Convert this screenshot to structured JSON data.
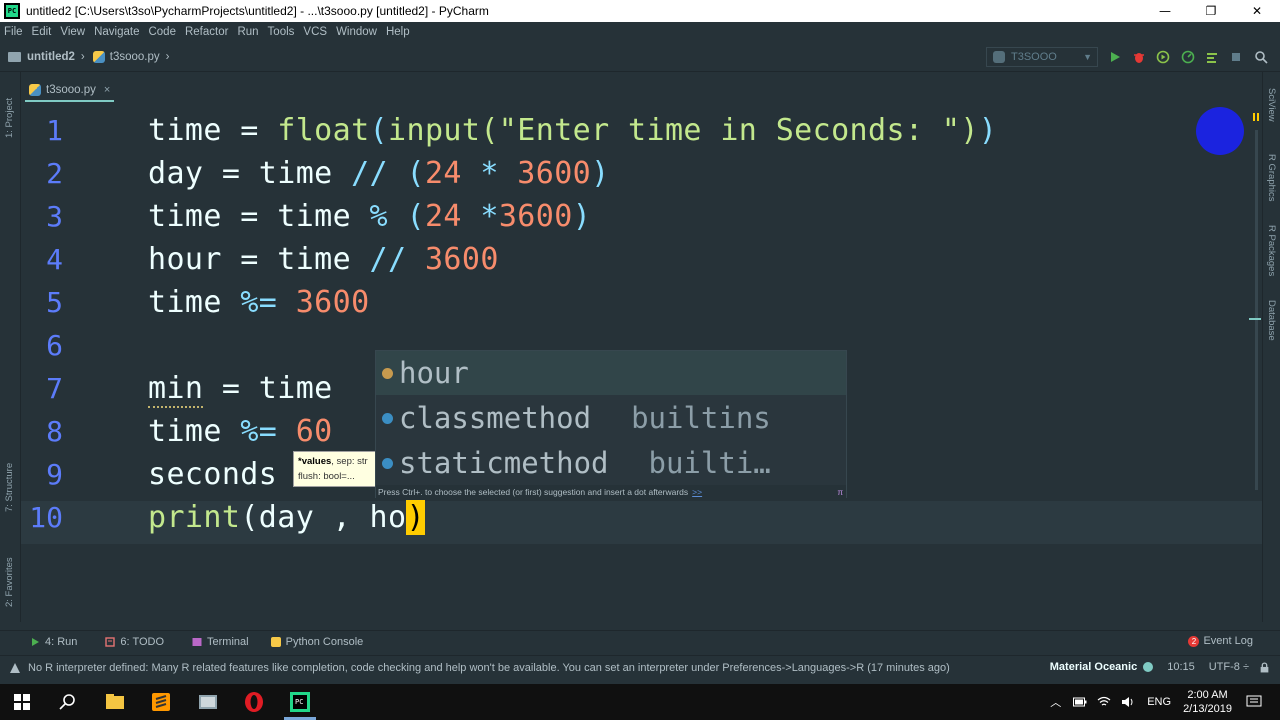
{
  "window": {
    "title": "untitled2 [C:\\Users\\t3so\\PycharmProjects\\untitled2] - ...\\t3sooo.py [untitled2] - PyCharm",
    "app_icon_text": "PC",
    "minimize": "—",
    "maximize": "❐",
    "close": "✕"
  },
  "menu": [
    "File",
    "Edit",
    "View",
    "Navigate",
    "Code",
    "Refactor",
    "Run",
    "Tools",
    "VCS",
    "Window",
    "Help"
  ],
  "navbar": {
    "project": "untitled2",
    "file": "t3sooo.py",
    "run_config": "T3SOOO"
  },
  "left_tools": {
    "project": "1: Project",
    "structure": "7: Structure",
    "favorites": "2: Favorites"
  },
  "right_tools": {
    "sciview": "SciView",
    "r_graphics": "R Graphics",
    "r_packages": "R Packages",
    "database": "Database"
  },
  "tab": {
    "name": "t3sooo.py",
    "close": "×"
  },
  "editor": {
    "line_numbers": [
      "1",
      "2",
      "3",
      "4",
      "5",
      "6",
      "7",
      "8",
      "9",
      "10"
    ],
    "lines": {
      "l1": {
        "a": "time = ",
        "b": "float",
        "c": "(",
        "d": "input",
        "e": "(\"Enter time in Seconds: \")",
        "f": ")"
      },
      "l2": {
        "a": "day = time ",
        "b": "//",
        "c": " (",
        "d": "24",
        "e": " * ",
        "f": "3600",
        "g": ")"
      },
      "l3": {
        "a": "time = time ",
        "b": "%",
        "c": " (",
        "d": "24",
        "e": " *",
        "f": "3600",
        "g": ")"
      },
      "l4": {
        "a": "hour = time ",
        "b": "//",
        "c": " ",
        "d": "3600"
      },
      "l5": {
        "a": "time ",
        "b": "%=",
        "c": " ",
        "d": "3600"
      },
      "l7": {
        "a": "min",
        "b": " = time"
      },
      "l8": {
        "a": "time ",
        "b": "%=",
        "c": " ",
        "d": "60"
      },
      "l9": {
        "a": "seconds"
      },
      "l10": {
        "a": "print",
        "b": "(day , ho",
        "c": ")"
      }
    }
  },
  "param_hint": {
    "line1_bold": "*values",
    "line1_rest": ", sep: str",
    "line2": "flush: bool=..."
  },
  "completion": {
    "items": [
      {
        "name": "hour",
        "source": ""
      },
      {
        "name": "classmethod",
        "source": "builtins"
      },
      {
        "name": "staticmethod",
        "source": "builti…"
      }
    ],
    "footer": "Press Ctrl+. to choose the selected (or first) suggestion and insert a dot afterwards",
    "footer_link": ">>",
    "footer_pi": "π"
  },
  "tool_windows": {
    "run": "4: Run",
    "todo": "6: TODO",
    "terminal": "Terminal",
    "python_console": "Python Console",
    "event_log": "Event Log",
    "event_count": "2"
  },
  "status": {
    "message": "No R interpreter defined: Many R related features like completion, code checking and help won't be available. You can set an interpreter under Preferences->Languages->R (17 minutes ago)",
    "theme": "Material Oceanic",
    "position": "10:15",
    "encoding": "UTF-8 ÷"
  },
  "taskbar": {
    "language": "ENG",
    "time": "2:00 AM",
    "date": "2/13/2019"
  },
  "colors": {
    "editor_bg": "#263238",
    "accent": "#80cbc4",
    "brace_highlight": "#ffcc00"
  }
}
